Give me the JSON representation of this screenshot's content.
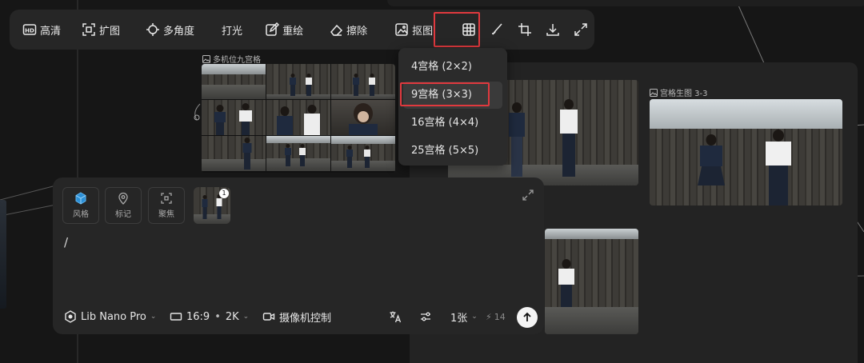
{
  "toolbar": {
    "items": [
      {
        "label": "高清",
        "icon": "hd-icon"
      },
      {
        "label": "扩图",
        "icon": "expand-image-icon"
      },
      {
        "label": "多角度",
        "icon": "multi-angle-icon"
      },
      {
        "label": "打光",
        "icon": "lighting-icon"
      },
      {
        "label": "重绘",
        "icon": "redraw-icon"
      },
      {
        "label": "擦除",
        "icon": "eraser-icon"
      },
      {
        "label": "抠图",
        "icon": "cutout-icon"
      }
    ],
    "icon_buttons": [
      "grid-icon",
      "brush-icon",
      "crop-icon",
      "download-icon",
      "fullscreen-icon"
    ]
  },
  "grid_menu": {
    "options": [
      "4宫格 (2×2)",
      "9宫格 (3×3)",
      "16宫格 (4×4)",
      "25宫格 (5×5)"
    ],
    "selected": "9宫格 (3×3)"
  },
  "nodes": {
    "left_label": "多机位九宫格",
    "right_label": "宫格生图 3-3"
  },
  "prompt_panel": {
    "chips": [
      {
        "label": "风格",
        "icon": "cube-icon"
      },
      {
        "label": "标记",
        "icon": "pin-icon"
      },
      {
        "label": "聚焦",
        "icon": "focus-icon"
      }
    ],
    "reference_count": "1",
    "prompt_text": "/",
    "model": "Lib Nano Pro",
    "aspect": "16:9",
    "resolution": "2K",
    "camera_control": "摄像机控制",
    "count": "1张",
    "credits": "14"
  },
  "colors": {
    "highlight_red": "#e0393e",
    "panel": "#262626",
    "background": "#161616"
  }
}
